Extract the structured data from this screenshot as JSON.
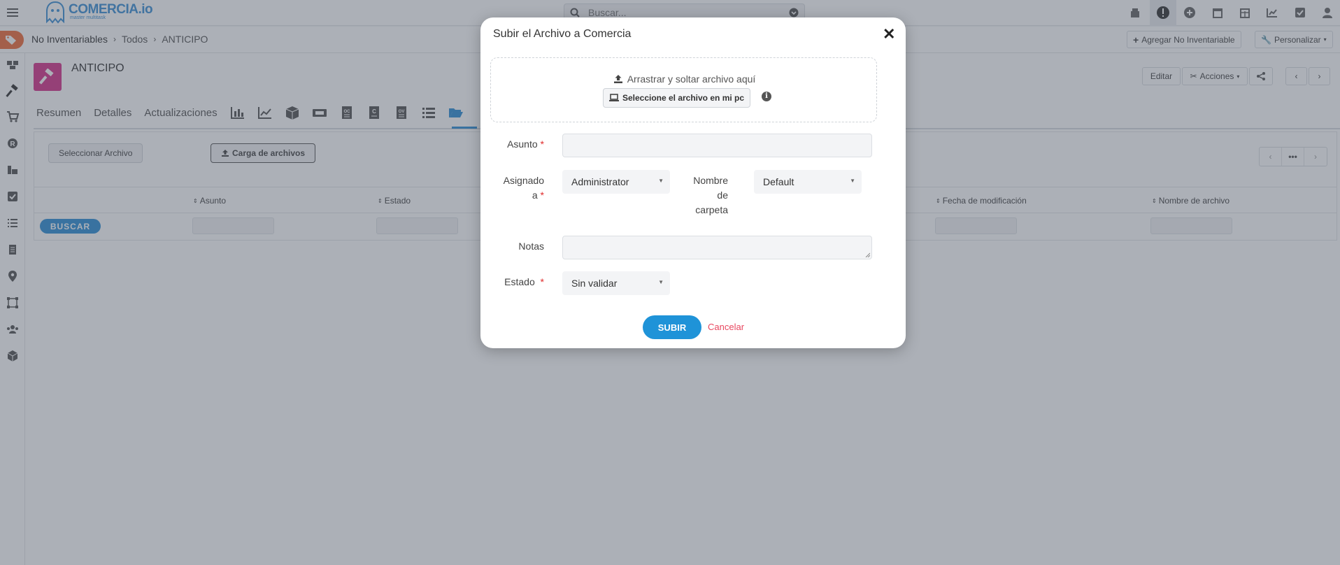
{
  "app": {
    "logo_text": "COMERCIA.io",
    "logo_sub": "master multitask",
    "search_placeholder": "Buscar..."
  },
  "breadcrumb": {
    "module": "No Inventariables",
    "list": "Todos",
    "record": "ANTICIPO"
  },
  "header_buttons": {
    "add": "Agregar No Inventariable",
    "customize": "Personalizar"
  },
  "record": {
    "title": "ANTICIPO",
    "edit": "Editar",
    "actions": "Acciones"
  },
  "tabs": [
    "Resumen",
    "Detalles",
    "Actualizaciones"
  ],
  "files_panel": {
    "select_button": "Seleccionar Archivo",
    "upload_button": "Carga de archivos",
    "search_button": "BUSCAR",
    "columns": [
      "Asunto",
      "Estado",
      "Fecha de modificación",
      "Nombre de archivo"
    ]
  },
  "modal": {
    "title": "Subir el Archivo a Comercia",
    "close": "✕",
    "drop_text": "Arrastrar y soltar archivo aquí",
    "pick_button": "Seleccione el archivo en mi pc",
    "fields": {
      "subject_label": "Asunto",
      "assigned_label_1": "Asignado",
      "assigned_label_2": "a",
      "assigned_value": "Administrator",
      "folder_label_1": "Nombre",
      "folder_label_2": "de",
      "folder_label_3": "carpeta",
      "folder_value": "Default",
      "notes_label": "Notas",
      "status_label": "Estado",
      "status_value": "Sin validar"
    },
    "submit": "SUBIR",
    "cancel": "Cancelar"
  },
  "colors": {
    "accent": "#2e8fd6",
    "record_icon": "#d6338a",
    "tag_badge": "#ef6c3b",
    "required": "#e02c2c",
    "cancel": "#e8475f"
  }
}
